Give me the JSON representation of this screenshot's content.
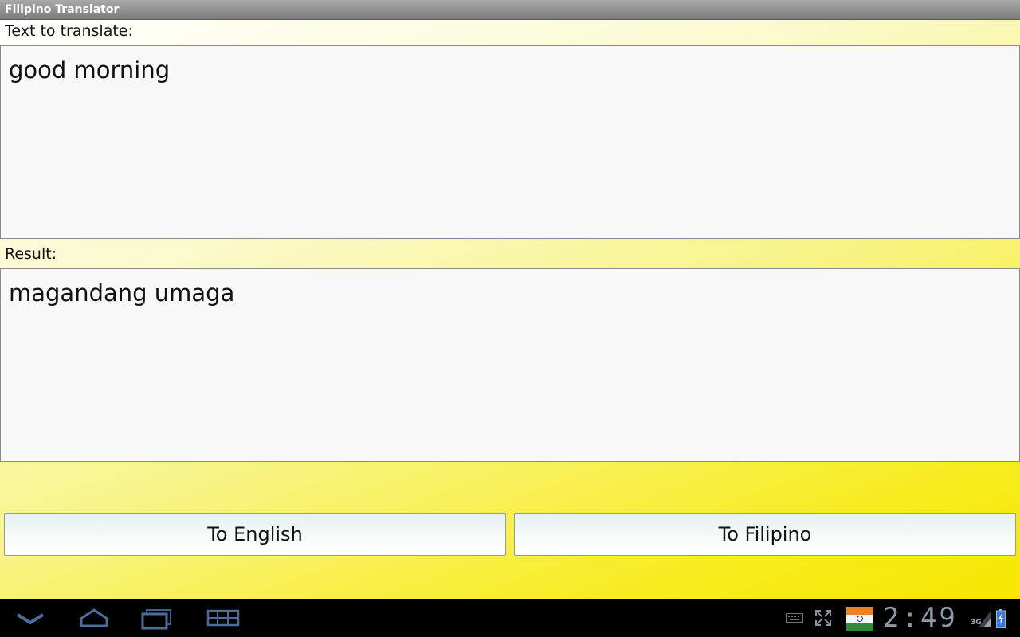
{
  "app": {
    "title": "Filipino Translator"
  },
  "input": {
    "label": "Text to translate:",
    "value": "good morning"
  },
  "result": {
    "label": "Result:",
    "value": "magandang umaga"
  },
  "buttons": {
    "to_english": "To English",
    "to_filipino": "To Filipino"
  },
  "system_bar": {
    "clock": "2:49",
    "network": "3G",
    "nav_icons": [
      "back-icon",
      "home-icon",
      "recent-apps-icon",
      "menu-icon"
    ],
    "tray_icons": [
      "keyboard-icon",
      "fullscreen-icon",
      "india-flag-icon",
      "signal-icon",
      "battery-icon"
    ]
  },
  "colors": {
    "background_gradient_start": "#ffffff",
    "background_gradient_end": "#f7e700",
    "title_bar": "#8f8f8f",
    "textbox_bg": "#f8f8f8",
    "button_bg": "#eef6f6",
    "system_bar_bg": "#000000",
    "clock": "#8e9aa8"
  }
}
